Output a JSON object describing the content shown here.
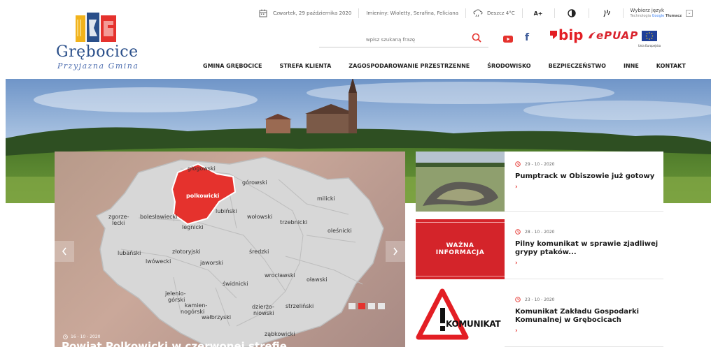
{
  "logo": {
    "name": "Grębocice",
    "slogan": "Przyjazna Gmina"
  },
  "topbar": {
    "date": "Czwartek, 29 października 2020",
    "nameday": "Imieniny: Wioletty, Serafina, Feliciana",
    "weather": "Deszcz 4°C",
    "font_size": "A+",
    "language_label": "Wybierz język",
    "translate_label": "Technologia",
    "translate_brand_google": "Google",
    "translate_brand_tlumacz": "Tłumacz"
  },
  "search": {
    "placeholder": "wpisz szukaną frazę"
  },
  "social": {
    "facebook": "f"
  },
  "logos": {
    "bip": "bip",
    "epuap": "ePUAP",
    "eu": "Unia Europejska"
  },
  "nav": {
    "items": [
      {
        "label": "GMINA GRĘBOCICE"
      },
      {
        "label": "STREFA KLIENTA"
      },
      {
        "label": "ZAGOSPODAROWANIE PRZESTRZENNE"
      },
      {
        "label": "ŚRODOWISKO"
      },
      {
        "label": "BEZPIECZEŃSTWO"
      },
      {
        "label": "INNE"
      },
      {
        "label": "KONTAKT"
      }
    ]
  },
  "slider": {
    "date": "16 - 10 - 2020",
    "title": "Powiat Polkowicki w czerwonej strefie",
    "map_labels": {
      "glogowski": "głogowski",
      "gorowski": "górowski",
      "polkowicki": "polkowicki",
      "milicki": "milicki",
      "zgorzelecki_1": "zgorze-",
      "zgorzelecki_2": "lecki",
      "boleslawiecki": "bolesławiecki",
      "lubinski": "lubiński",
      "wolowski": "wołowski",
      "trzebnicki": "trzebnicki",
      "olesnicki": "oleśnicki",
      "legnicki": "legnicki",
      "lubanski": "lubański",
      "zlotoryjski": "złotoryjski",
      "sredzki": "średzki",
      "lwowecki": "lwówecki",
      "jaworski": "jaworski",
      "wroclawski": "wrocławski",
      "olawski": "oławski",
      "swidnicki": "świdnicki",
      "jeleniogorski_1": "jelenio-",
      "jeleniogorski_2": "górski",
      "kamiennogorski_1": "kamien-",
      "kamiennogorski_2": "nogórski",
      "dzierzoniowski_1": "dzierżo-",
      "dzierzoniowski_2": "niowski",
      "strzelinski": "strzeliński",
      "walbrzyski": "wałbrzyski",
      "zabkowicki": "ząbkowicki"
    }
  },
  "news": [
    {
      "date": "29 - 10 - 2020",
      "title": "Pumptrack w Obiszowie już gotowy",
      "more": "›"
    },
    {
      "date": "28 - 10 - 2020",
      "title": "Pilny komunikat w sprawie zjadliwej grypy ptaków...",
      "more": "›",
      "thumb_text_1": "WAŻNA",
      "thumb_text_2": "INFORMACJA"
    },
    {
      "date": "23 - 10 - 2020",
      "title": "Komunikat Zakładu Gospodarki Komunalnej w Grębocicach",
      "more": "›",
      "thumb_text": "KOMUNIKAT"
    }
  ],
  "colors": {
    "accent": "#e5322d",
    "logo_blue": "#2a4f8a",
    "bip_red": "#e31e24",
    "epuap_red": "#d9232d",
    "eu_blue": "#1f3f99"
  }
}
